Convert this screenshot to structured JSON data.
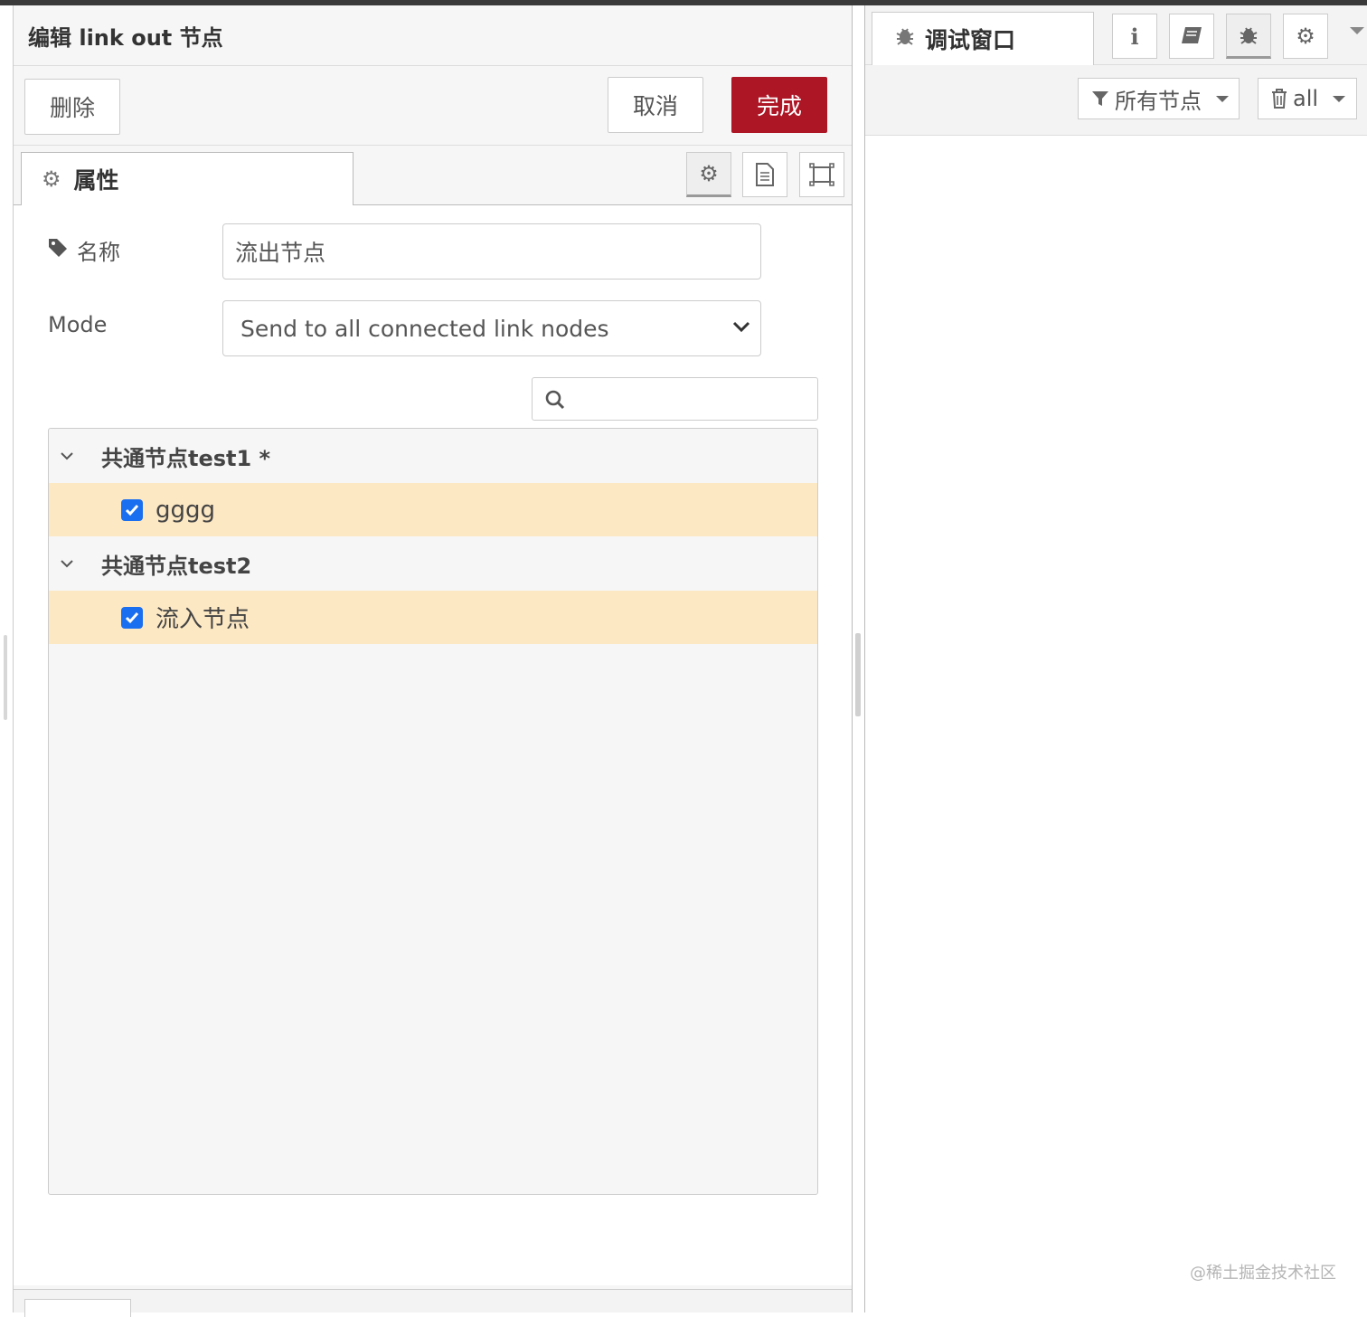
{
  "editor": {
    "title": "编辑 link out 节点",
    "delete_label": "删除",
    "cancel_label": "取消",
    "done_label": "完成",
    "done_color": "#ad1625",
    "tab_properties": "属性"
  },
  "form": {
    "name_label": "名称",
    "name_value": "流出节点",
    "mode_label": "Mode",
    "mode_value": "Send to all connected link nodes",
    "search_placeholder": ""
  },
  "tree": [
    {
      "group": "共通节点test1 *",
      "items": [
        {
          "label": "gggg",
          "checked": true
        }
      ]
    },
    {
      "group": "共通节点test2",
      "items": [
        {
          "label": "流入节点",
          "checked": true
        }
      ]
    }
  ],
  "sidebar": {
    "tab_debug": "调试窗口",
    "filter_label": "所有节点",
    "clear_label": "all"
  },
  "watermark": "@稀土掘金技术社区",
  "colors": {
    "highlight_row": "#fde8c4",
    "checkbox": "#1a6ef0"
  },
  "icons": [
    "gear-icon",
    "document-icon",
    "frame-icon",
    "tag-icon",
    "search-icon",
    "chevron-down-icon",
    "bug-icon",
    "info-icon",
    "book-icon",
    "filter-icon",
    "trash-icon"
  ]
}
